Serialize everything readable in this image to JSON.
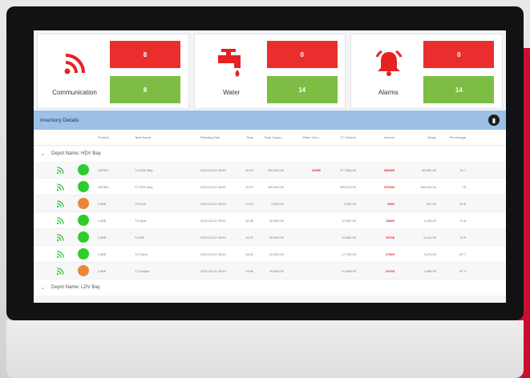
{
  "kpis": [
    {
      "label": "Communication",
      "icon": "wifi-icon",
      "top_value": "8",
      "bottom_value": "8"
    },
    {
      "label": "Water",
      "icon": "water-tap-icon",
      "top_value": "0",
      "bottom_value": "14"
    },
    {
      "label": "Alarms",
      "icon": "alarm-bell-icon",
      "top_value": "0",
      "bottom_value": "14"
    }
  ],
  "inventory": {
    "title": "Inventory Details",
    "columns": [
      "",
      "",
      "Product",
      "Tank Name",
      "Reading Date",
      "Time",
      "Tank Capac...",
      "Water Volu...",
      "TC Volume",
      "Volume",
      "Ullage",
      "Percentage"
    ],
    "groups": [
      {
        "name": "Depot Name: HDV Bay",
        "rows": [
          {
            "status": "#2ecc2e",
            "product": "DIESEL",
            "tank": "T4-HDV Bay",
            "date": "2022-03-22 09:00",
            "time": "10:24",
            "capacity": "500,000.00",
            "water": "24096",
            "tc_volume": "377,564.00",
            "volume": "382549",
            "ullage": "90,950.00",
            "pct": "76.7"
          },
          {
            "status": "#2ecc2e",
            "product": "DIESEL",
            "tank": "T7-HDV Bay",
            "date": "2022-03-22 09:00",
            "time": "10:07",
            "capacity": "500,000.00",
            "water": "",
            "tc_volume": "305,275.00",
            "volume": "375184",
            "ullage": "156,944.00",
            "pct": "75"
          },
          {
            "status": "#e8873a",
            "product": "LUBE",
            "tank": "T3 Cool",
            "date": "2022-03-22 09:00",
            "time": "17:13",
            "capacity": "5,000.00",
            "water": "",
            "tc_volume": "4,394.00",
            "volume": "4532",
            "ullage": "457.00",
            "pct": "90.8"
          },
          {
            "status": "#2ecc2e",
            "product": "LUBE",
            "tank": "T3 Hydr",
            "date": "2022-03-22 09:00",
            "time": "14:36",
            "capacity": "20,000.00",
            "water": "",
            "tc_volume": "19,587.00",
            "volume": "14820",
            "ullage": "4,145.00",
            "pct": "74.8"
          },
          {
            "status": "#2ecc2e",
            "product": "LUBE",
            "tank": "T4 Diff",
            "date": "2022-03-22 09:00",
            "time": "14:37",
            "capacity": "20,000.00",
            "water": "",
            "tc_volume": "15,680.00",
            "volume": "15728",
            "ullage": "5,241.00",
            "pct": "74.5"
          },
          {
            "status": "#2ecc2e",
            "product": "LUBE",
            "tank": "T2 Trans",
            "date": "2022-03-22 09:00",
            "time": "14:02",
            "capacity": "20,000.00",
            "water": "",
            "tc_volume": "17,750.00",
            "volume": "17829",
            "ullage": "3,470.00",
            "pct": "87.7"
          },
          {
            "status": "#e8873a",
            "product": "LUBE",
            "tank": "T1 Engine",
            "date": "2022-03-22 09:00",
            "time": "13:56",
            "capacity": "26,000.00",
            "water": "",
            "tc_volume": "22,848.00",
            "volume": "22133",
            "ullage": "2,866.00",
            "pct": "87.2"
          }
        ]
      },
      {
        "name": "Depot Name: LDV Bay",
        "rows": []
      }
    ]
  }
}
